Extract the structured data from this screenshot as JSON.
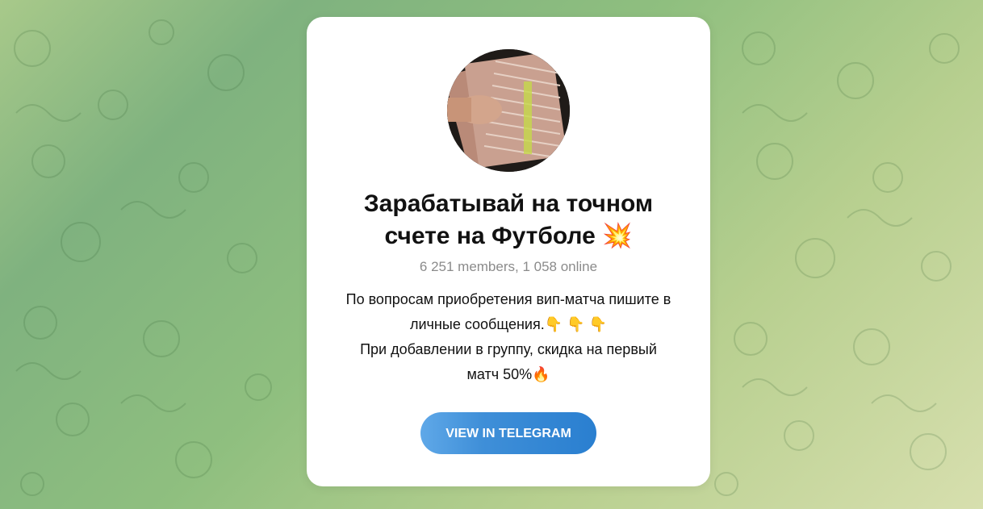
{
  "channel": {
    "title_line1": "Зарабатывай на точном",
    "title_line2": "счете на Футболе",
    "title_emoji": "💥",
    "members": "6 251 members, 1 058 online",
    "description": {
      "line1": "По вопросам приобретения вип-матча пишите в",
      "line2": "личные сообщения.",
      "line2_emoji": "👇 👇 👇",
      "line3": "При добавлении в группу, скидка на первый",
      "line4": "матч 50%",
      "line4_emoji": "🔥"
    },
    "button_label": "VIEW IN TELEGRAM",
    "avatar_icon": "money-stack-photo"
  },
  "colors": {
    "button_start": "#5fa8e8",
    "button_end": "#2a7fd0",
    "background_green": "#8fbf7f"
  }
}
